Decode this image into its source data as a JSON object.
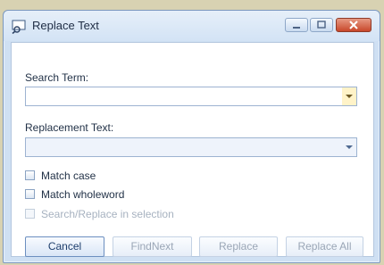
{
  "window": {
    "title": "Replace Text"
  },
  "form": {
    "search_label": "Search Term:",
    "search_value": "",
    "replace_label": "Replacement Text:",
    "replace_value": ""
  },
  "options": [
    {
      "label": "Match case",
      "checked": false,
      "enabled": true
    },
    {
      "label": "Match wholeword",
      "checked": false,
      "enabled": true
    },
    {
      "label": "Search/Replace in selection",
      "checked": false,
      "enabled": false
    }
  ],
  "buttons": {
    "cancel": "Cancel",
    "find_next": "FindNext",
    "replace": "Replace",
    "replace_all": "Replace All"
  },
  "icons": {
    "app": "find-replace-icon",
    "minimize": "minimize-icon",
    "maximize": "maximize-icon",
    "close": "close-icon",
    "dropdown": "chevron-down-icon"
  },
  "colors": {
    "window_bg": "#cfe0f3",
    "client_bg": "#ffffff",
    "close_button": "#c8472a",
    "dropdown_highlight": "#fff3c8"
  }
}
